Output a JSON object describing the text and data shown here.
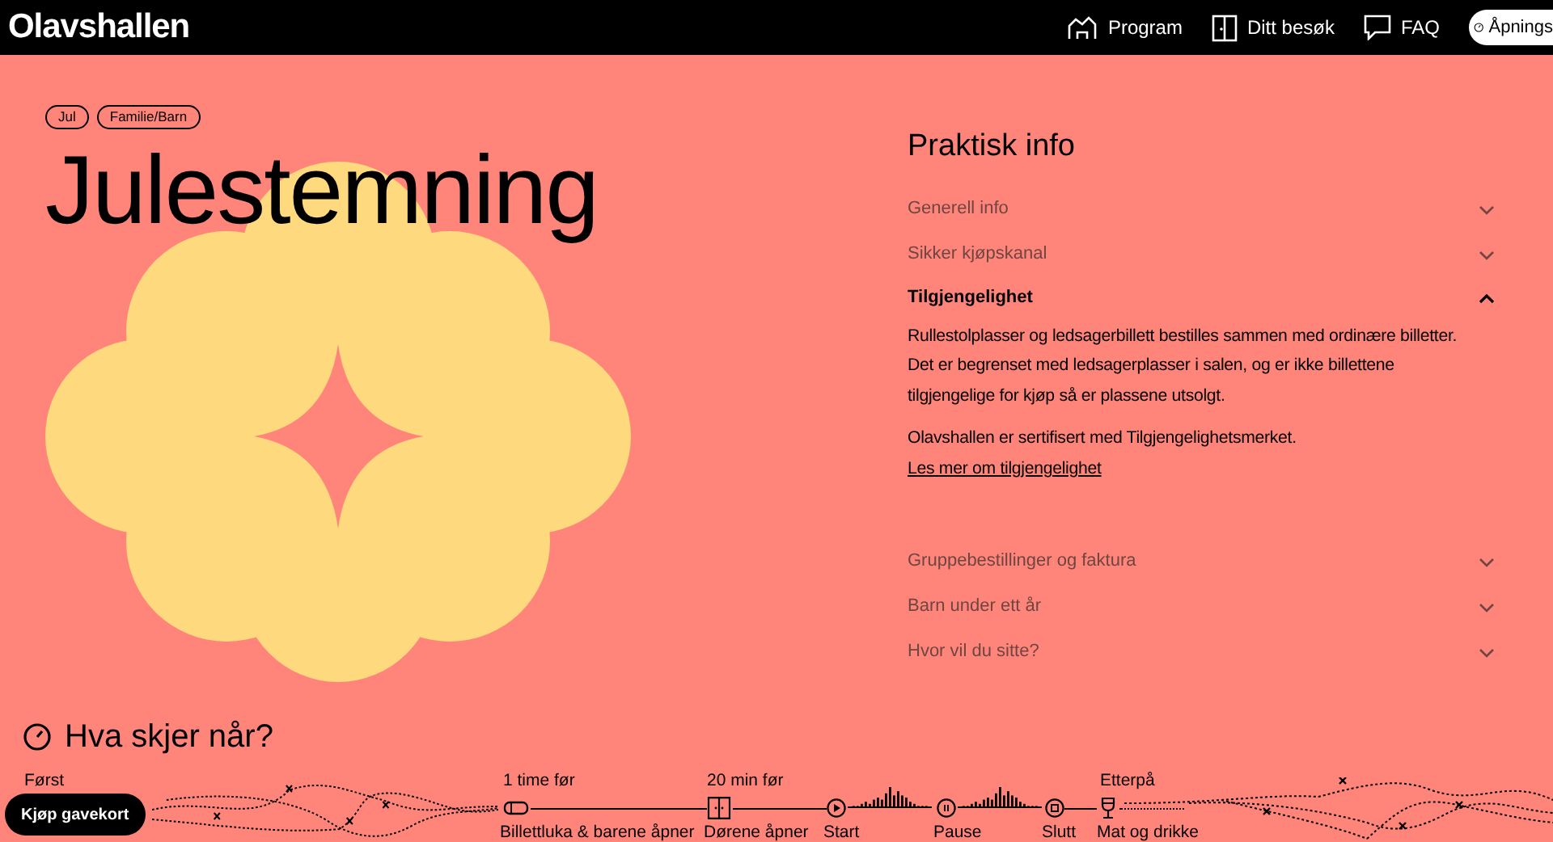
{
  "header": {
    "logo": "Olavshallen",
    "nav": [
      {
        "kind": "program",
        "label": "Program"
      },
      {
        "kind": "visit",
        "label": "Ditt besøk"
      },
      {
        "kind": "faq",
        "label": "FAQ"
      }
    ],
    "hours_button": "Åpnings"
  },
  "event": {
    "tags": [
      "Jul",
      "Familie/Barn"
    ],
    "title": "Julestemning"
  },
  "practical_info": {
    "heading": "Praktisk info",
    "items": [
      {
        "title": "Generell info",
        "expanded": false
      },
      {
        "title": "Sikker kjøpskanal",
        "expanded": false
      },
      {
        "title": "Tilgjengelighet",
        "expanded": true,
        "body": [
          {
            "text": "Rullestolplasser og ledsagerbillett bestilles sammen med ordinære billetter. Det er begrenset med ledsagerplasser i salen, og er ikke billettene tilgjengelige for kjøp så er plassene utsolgt."
          },
          {
            "text": "Olavshallen er sertifisert med Tilgjengelighetsmerket.",
            "link": "Les mer om tilgjengelighet"
          }
        ]
      },
      {
        "title": "Gruppebestillinger og faktura",
        "expanded": false
      },
      {
        "title": "Barn under ett år",
        "expanded": false
      },
      {
        "title": "Hvor vil du sitte?",
        "expanded": false
      }
    ]
  },
  "timeline": {
    "heading": "Hva skjer når?",
    "first_label": "Først",
    "steps": [
      {
        "kind": "ticket",
        "above": "1 time før",
        "below": "Billettluka & barene åpner"
      },
      {
        "kind": "door",
        "above": "20 min før",
        "below": "Dørene åpner"
      },
      {
        "kind": "start",
        "below": "Start"
      },
      {
        "kind": "pause",
        "below": "Pause"
      },
      {
        "kind": "stop",
        "below": "Slutt"
      },
      {
        "kind": "glass",
        "above": "Etterpå",
        "below": "Mat og drikke"
      }
    ]
  },
  "gift_card_button": "Kjøp gavekort"
}
